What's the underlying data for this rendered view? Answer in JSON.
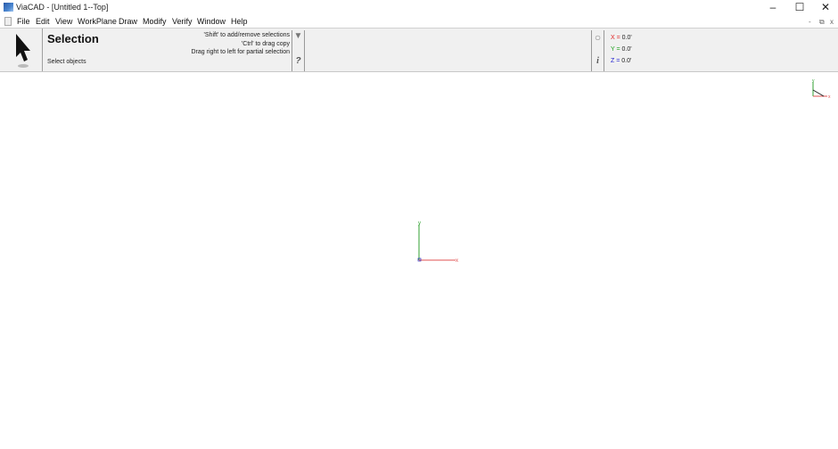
{
  "window": {
    "title": "ViaCAD - [Untitled 1--Top]",
    "controls": {
      "minimize": "–",
      "maximize": "☐",
      "close": "✕"
    },
    "mdi_controls": {
      "minimize": "-",
      "restore": "⧉",
      "close": "x"
    }
  },
  "menu": {
    "items": [
      "File",
      "Edit",
      "View",
      "WorkPlane",
      "Draw",
      "Modify",
      "Verify",
      "Window",
      "Help"
    ]
  },
  "toolbar": {
    "tool_icon": "arrow-cursor-icon",
    "tool_name": "Selection",
    "tool_prompt": "Select objects",
    "hints": [
      "'Shift' to add/remove selections",
      "'Ctrl' to drag copy",
      "Drag right to left for partial selection"
    ],
    "dropdown_glyph": "▼",
    "help_glyph": "?",
    "snap_glyph": "○",
    "info_glyph": "i"
  },
  "coordinates": {
    "x": {
      "label": "X",
      "value": "0.0'",
      "color": "#e02020"
    },
    "y": {
      "label": "Y",
      "value": "0.0'",
      "color": "#18a018"
    },
    "z": {
      "label": "Z",
      "value": "0.0'",
      "color": "#2020d0"
    }
  },
  "viewport": {
    "axis_labels": {
      "x": "x",
      "y": "y"
    },
    "axis_colors": {
      "x": "#e05050",
      "y": "#30a030",
      "z": "#3030c0"
    }
  }
}
